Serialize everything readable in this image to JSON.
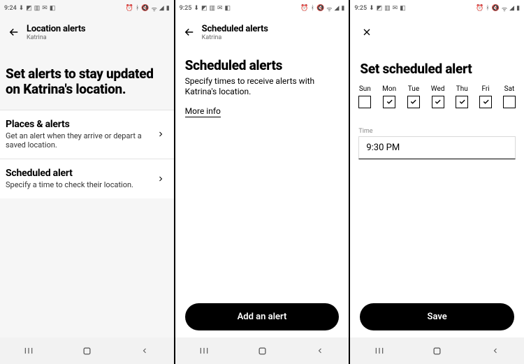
{
  "screen1": {
    "statusbar": {
      "time": "9:24"
    },
    "header": {
      "title": "Location alerts",
      "subtitle": "Katrina"
    },
    "heading": "Set alerts to stay updated on Katrina's location.",
    "rows": {
      "places": {
        "label": "Places & alerts",
        "desc": "Get an alert when they arrive or depart a saved location."
      },
      "scheduled": {
        "label": "Scheduled alert",
        "desc": "Specify a time to check their location."
      }
    }
  },
  "screen2": {
    "statusbar": {
      "time": "9:25"
    },
    "header": {
      "title": "Scheduled alerts",
      "subtitle": "Katrina"
    },
    "heading": "Scheduled alerts",
    "desc": "Specify times to receive alerts with Katrina's location.",
    "more_info": "More info",
    "cta": "Add an alert"
  },
  "screen3": {
    "statusbar": {
      "time": "9:25"
    },
    "heading": "Set scheduled alert",
    "days": {
      "labels": [
        "Sun",
        "Mon",
        "Tue",
        "Wed",
        "Thu",
        "Fri",
        "Sat"
      ],
      "checked": [
        false,
        true,
        true,
        true,
        true,
        true,
        false
      ]
    },
    "time": {
      "label": "Time",
      "value": "9:30 PM"
    },
    "cta": "Save"
  }
}
